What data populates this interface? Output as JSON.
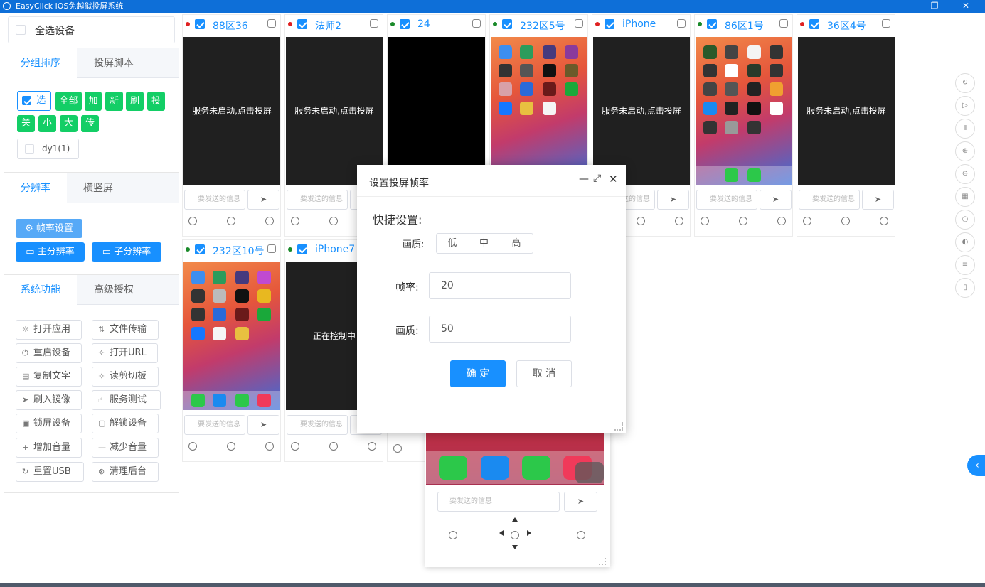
{
  "window": {
    "title": "EasyClick iOS免越狱投屏系统"
  },
  "select_all": {
    "label": "全选设备"
  },
  "group_panel": {
    "tabs": [
      "分组排序",
      "投屏脚本"
    ],
    "buttons": [
      "选",
      "全部",
      "加",
      "新",
      "刷",
      "投",
      "关",
      "小",
      "大",
      "传"
    ],
    "group": "dy1(1)"
  },
  "resolution_panel": {
    "tabs": [
      "分辨率",
      "横竖屏"
    ],
    "frame_btn": "帧率设置",
    "main_res": "主分辨率",
    "sub_res": "子分辨率"
  },
  "system_panel": {
    "tabs": [
      "系统功能",
      "高级授权"
    ],
    "functions": [
      {
        "label": "打开应用",
        "icon": "sun-icon"
      },
      {
        "label": "文件传输",
        "icon": "transfer-icon"
      },
      {
        "label": "重启设备",
        "icon": "power-icon"
      },
      {
        "label": "打开URL",
        "icon": "link-icon"
      },
      {
        "label": "复制文字",
        "icon": "document-icon"
      },
      {
        "label": "读剪切板",
        "icon": "clipboard-icon"
      },
      {
        "label": "刷入镜像",
        "icon": "send-icon"
      },
      {
        "label": "服务测试",
        "icon": "hand-icon"
      },
      {
        "label": "锁屏设备",
        "icon": "lock-icon"
      },
      {
        "label": "解锁设备",
        "icon": "unlock-icon"
      },
      {
        "label": "增加音量",
        "icon": "plus-icon"
      },
      {
        "label": "减少音量",
        "icon": "minus-icon"
      },
      {
        "label": "重置USB",
        "icon": "refresh-icon"
      },
      {
        "label": "清理后台",
        "icon": "close-circle-icon"
      }
    ]
  },
  "devices": [
    {
      "name": "88区36",
      "status_color": "#e02020",
      "screen": "服务未启动,点击投屏"
    },
    {
      "name": "法师2",
      "status_color": "#e02020",
      "screen": "服务未启动,点击投屏"
    },
    {
      "name": "24",
      "status_color": "#1a8a2a",
      "screen": ""
    },
    {
      "name": "232区5号",
      "status_color": "#1a8a2a",
      "screen": ""
    },
    {
      "name": "iPhone",
      "status_color": "#e02020",
      "screen": "服务未启动,点击投屏"
    },
    {
      "name": "86区1号",
      "status_color": "#1a8a2a",
      "screen": ""
    },
    {
      "name": "36区4号",
      "status_color": "#e02020",
      "screen": "服务未启动,点击投屏"
    },
    {
      "name": "232区10号",
      "status_color": "#1a8a2a",
      "screen": ""
    },
    {
      "name": "iPhone7",
      "status_color": "#1a8a2a",
      "screen": "正在控制中"
    }
  ],
  "message_placeholder": "要发送的信息",
  "modal": {
    "title": "设置投屏帧率",
    "quick_label": "快捷设置:",
    "quality_label": "画质:",
    "quality_options": [
      "低",
      "中",
      "高"
    ],
    "fps_label": "帧率:",
    "fps_value": "20",
    "quality2_label": "画质:",
    "quality2_value": "50",
    "ok": "确 定",
    "cancel": "取 消"
  },
  "colors": {
    "accent": "#1890ff",
    "green": "#13ce66",
    "titlebar": "#0e6fd8"
  }
}
